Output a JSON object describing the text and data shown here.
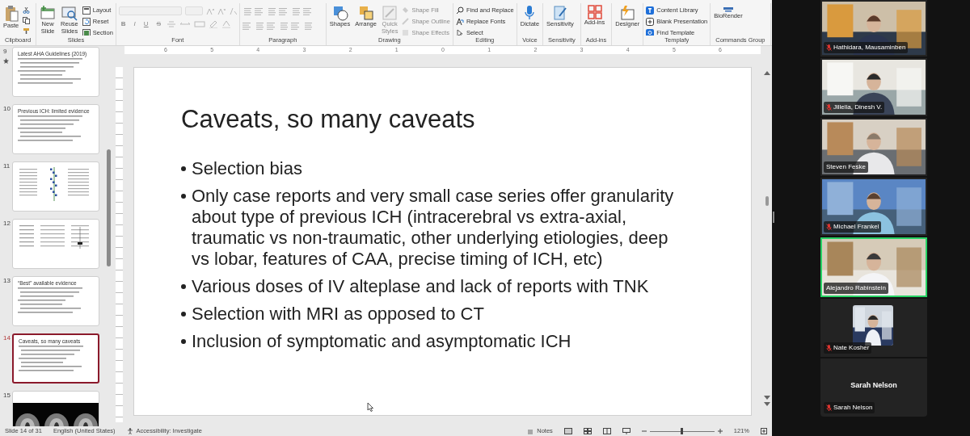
{
  "ribbon": {
    "groups": [
      {
        "kind": "buttons",
        "label": "Clipboard",
        "large": [
          {
            "label": "Paste",
            "disabled": false
          }
        ]
      },
      {
        "kind": "buttons",
        "label": "Slides",
        "large": [
          {
            "label": "New Slide",
            "disabled": false
          },
          {
            "label": "Reuse Slides",
            "disabled": false
          }
        ],
        "small": [
          {
            "label": "Layout",
            "disabled": false
          },
          {
            "label": "Reset",
            "disabled": false
          },
          {
            "label": "Section",
            "disabled": false
          }
        ]
      },
      {
        "kind": "font",
        "label": "Font",
        "letters": [
          "B",
          "I",
          "U",
          "S"
        ],
        "disabled": true
      },
      {
        "kind": "paragraph",
        "label": "Paragraph",
        "disabled": true
      },
      {
        "kind": "buttons",
        "label": "Drawing",
        "large": [
          {
            "label": "Shapes",
            "disabled": false
          },
          {
            "label": "Arrange",
            "disabled": false
          },
          {
            "label": "Quick Styles",
            "disabled": true
          }
        ],
        "small": [
          {
            "label": "Shape Fill",
            "disabled": true
          },
          {
            "label": "Shape Outline",
            "disabled": true
          },
          {
            "label": "Shape Effects",
            "disabled": true
          }
        ]
      },
      {
        "kind": "buttons",
        "label": "Editing",
        "small": [
          {
            "label": "Find and Replace",
            "disabled": false
          },
          {
            "label": "Replace Fonts",
            "disabled": false
          },
          {
            "label": "Select",
            "disabled": false
          }
        ]
      },
      {
        "kind": "buttons",
        "label": "Voice",
        "large": [
          {
            "label": "Dictate",
            "disabled": false
          }
        ]
      },
      {
        "kind": "buttons",
        "label": "Sensitivity",
        "large": [
          {
            "label": "Sensitivity",
            "disabled": false
          }
        ]
      },
      {
        "kind": "buttons",
        "label": "Add-ins",
        "large": [
          {
            "label": "Add-ins",
            "disabled": false
          }
        ]
      },
      {
        "kind": "buttons",
        "large": [
          {
            "label": "Designer",
            "disabled": false
          }
        ]
      },
      {
        "kind": "buttons",
        "label": "Templafy",
        "small": [
          {
            "label": "Content Library",
            "disabled": false
          },
          {
            "label": "Blank Presentation",
            "disabled": false
          },
          {
            "label": "Find Template",
            "disabled": false
          }
        ]
      },
      {
        "kind": "buttons",
        "label": "Commands Group",
        "large": [
          {
            "label": "BioRender",
            "disabled": false
          }
        ]
      }
    ]
  },
  "ruler": {
    "labels": [
      "6",
      "5",
      "4",
      "3",
      "2",
      "1",
      "0",
      "1",
      "2",
      "3",
      "4",
      "5",
      "6"
    ]
  },
  "thumbnails": [
    {
      "number": "9",
      "title": "Latest AHA Guidelines (2019)",
      "kind": "text",
      "selected": false,
      "animated": true
    },
    {
      "number": "10",
      "title": "Previous ICH: limited evidence",
      "kind": "text",
      "selected": false,
      "animated": false
    },
    {
      "number": "11",
      "kind": "plot",
      "selected": false,
      "animated": false
    },
    {
      "number": "12",
      "kind": "table",
      "selected": false,
      "animated": false
    },
    {
      "number": "13",
      "title": "“Best” available evidence",
      "kind": "text",
      "selected": false,
      "animated": false
    },
    {
      "number": "14",
      "title": "Caveats, so many caveats",
      "kind": "text",
      "selected": true,
      "animated": false
    },
    {
      "number": "15",
      "selected": false,
      "animated": false
    }
  ],
  "slide": {
    "title": "Caveats, so many caveats",
    "bullets": [
      "Selection bias",
      "Only case reports and very small case series offer granularity about type of previous ICH (intracerebral vs extra-axial, traumatic vs non-traumatic, other underlying etiologies, deep vs lobar, features of CAA, precise timing of ICH, etc)",
      "Various doses of IV alteplase and lack of reports with TNK",
      "Selection with MRI as opposed to CT",
      "Inclusion of symptomatic and asymptomatic ICH"
    ]
  },
  "status_bar": {
    "slide_position": "Slide 14 of 31",
    "language": "English (United States)",
    "accessibility": "Accessibility: Investigate",
    "notes": "Notes",
    "zoom": "121%",
    "zoom_slider": {
      "level": 0.5
    }
  },
  "participants": [
    {
      "name": "Hathidara, Mausaminben",
      "kind": "video",
      "muted": true,
      "speaking": false
    },
    {
      "name": "Jillella, Dinesh V.",
      "kind": "video",
      "muted": true,
      "speaking": false
    },
    {
      "name": "Steven Feske",
      "kind": "video",
      "muted": false,
      "speaking": false
    },
    {
      "name": "Michael Frankel",
      "kind": "video",
      "muted": true,
      "speaking": false
    },
    {
      "name": "Alejandro Rabinstein",
      "kind": "video",
      "muted": false,
      "speaking": true
    },
    {
      "name": "Nate Kosher",
      "kind": "avatar",
      "muted": true,
      "speaking": false
    },
    {
      "name": "Sarah Nelson",
      "kind": "name",
      "display_name": "Sarah Nelson",
      "muted": true,
      "speaking": false
    }
  ]
}
